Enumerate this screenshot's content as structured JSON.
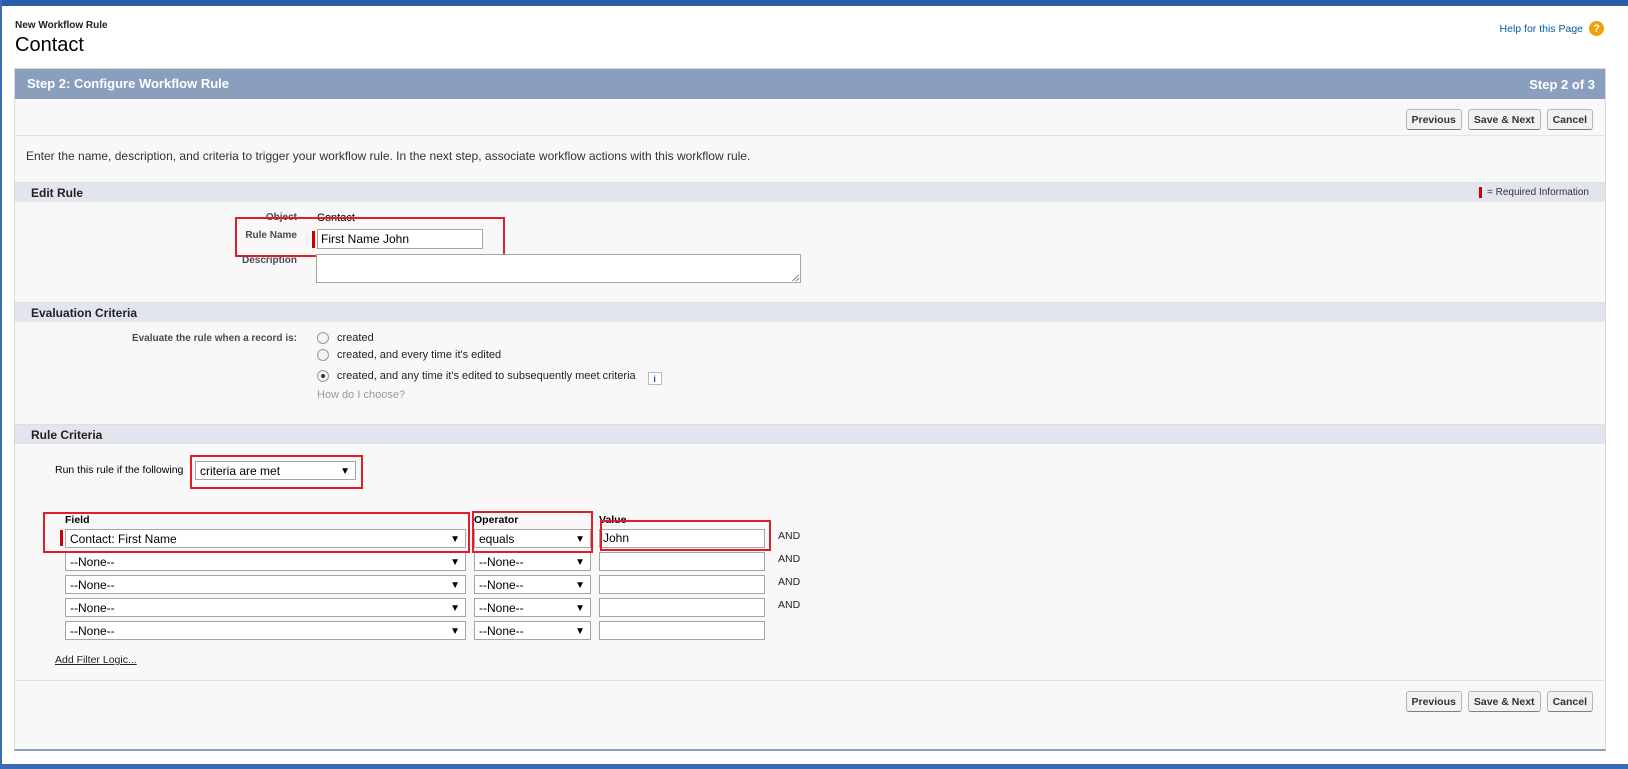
{
  "header": {
    "subtitle": "New Workflow Rule",
    "title": "Contact",
    "help_link": "Help for this Page",
    "help_icon": "question-icon"
  },
  "step": {
    "title": "Step 2: Configure Workflow Rule",
    "count": "Step 2 of 3"
  },
  "buttons": {
    "previous": "Previous",
    "save_next": "Save & Next",
    "cancel": "Cancel"
  },
  "intro_text": "Enter the name, description, and criteria to trigger your workflow rule. In the next step, associate workflow actions with this workflow rule.",
  "edit_rule": {
    "section_title": "Edit Rule",
    "required_legend": "= Required Information",
    "object_label": "Object",
    "object_value": "Contact",
    "rule_name_label": "Rule Name",
    "rule_name_value": "First Name John",
    "description_label": "Description",
    "description_value": ""
  },
  "evaluation": {
    "section_title": "Evaluation Criteria",
    "label": "Evaluate the rule when a record is:",
    "options": [
      {
        "label": "created",
        "selected": false
      },
      {
        "label": "created, and every time it's edited",
        "selected": false
      },
      {
        "label": "created, and any time it's edited to subsequently meet criteria",
        "selected": true
      }
    ],
    "info_icon": "info-icon",
    "how_link": "How do I choose?"
  },
  "criteria": {
    "section_title": "Rule Criteria",
    "run_label": "Run this rule if the following",
    "run_value": "criteria are met",
    "col_field": "Field",
    "col_operator": "Operator",
    "col_value": "Value",
    "rows": [
      {
        "field": "Contact: First Name",
        "operator": "equals",
        "value": "John",
        "conj": "AND"
      },
      {
        "field": "--None--",
        "operator": "--None--",
        "value": "",
        "conj": "AND"
      },
      {
        "field": "--None--",
        "operator": "--None--",
        "value": "",
        "conj": "AND"
      },
      {
        "field": "--None--",
        "operator": "--None--",
        "value": "",
        "conj": "AND"
      },
      {
        "field": "--None--",
        "operator": "--None--",
        "value": "",
        "conj": ""
      }
    ],
    "add_filter_logic": "Add Filter Logic..."
  },
  "colors": {
    "step_bar": "#8a9ebe",
    "section_bar": "#e2e5ee",
    "highlight": "#e21d2b",
    "required": "#cc0000"
  }
}
